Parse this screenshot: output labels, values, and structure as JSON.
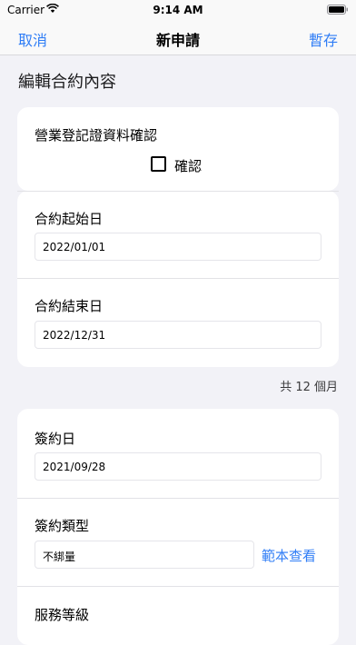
{
  "status_bar": {
    "carrier": "Carrier",
    "time": "9:14 AM"
  },
  "nav": {
    "left_label": "取消",
    "title": "新申請",
    "right_label": "暫存"
  },
  "section_title": "編輯合約內容",
  "business_card": {
    "label": "營業登記證資料確認",
    "checkbox_label": "確認",
    "checked": false
  },
  "date_card": {
    "start_label": "合約起始日",
    "start_value": "2022/01/01",
    "end_label": "合約結束日",
    "end_value": "2022/12/31"
  },
  "duration_text": "共 12 個月",
  "contract_card": {
    "sign_date_label": "簽約日",
    "sign_date_value": "2021/09/28",
    "sign_type_label": "簽約類型",
    "sign_type_value": "不綁量",
    "sample_link": "範本查看",
    "service_level_label": "服務等級"
  }
}
